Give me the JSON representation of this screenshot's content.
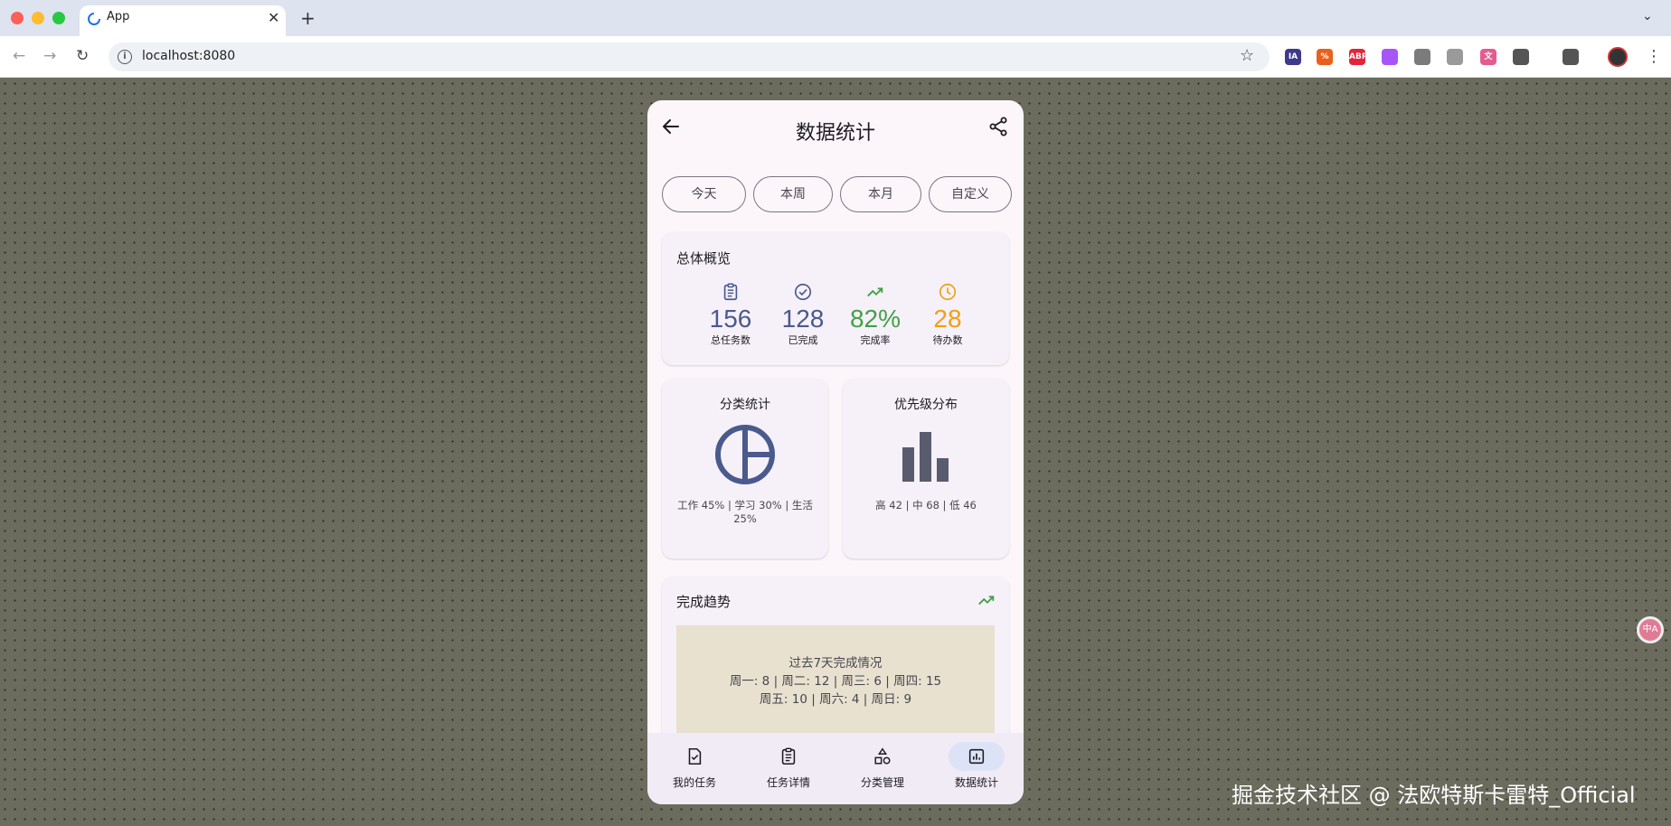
{
  "browser": {
    "tab_title": "App",
    "url": "localhost:8080",
    "tab_close": "✕",
    "new_tab": "+",
    "tab_menu": "⌄",
    "extensions": [
      {
        "name": "ia-extension-icon",
        "label": "IA",
        "color": "#3d3a8c"
      },
      {
        "name": "percent-extension-icon",
        "label": "%",
        "color": "#e8601c"
      },
      {
        "name": "adblock-extension-icon",
        "label": "ABP",
        "color": "#e5243b"
      },
      {
        "name": "purple-extension-icon",
        "label": "",
        "color": "#a855f7"
      },
      {
        "name": "shield-extension-icon",
        "label": "",
        "color": "#7b7b7b"
      },
      {
        "name": "gray-extension-icon",
        "label": "",
        "color": "#9a9a9a"
      },
      {
        "name": "translate-extension-icon",
        "label": "文",
        "color": "#e45c8f"
      },
      {
        "name": "puzzle-extension-icon",
        "label": "",
        "color": "#555555"
      },
      {
        "name": "qr-extension-icon",
        "label": "",
        "color": "#555555"
      }
    ]
  },
  "app": {
    "title": "数据统计",
    "filters": [
      "今天",
      "本周",
      "本月",
      "自定义"
    ],
    "overview": {
      "title": "总体概览",
      "stats": [
        {
          "icon": "clipboard-icon",
          "value": "156",
          "label": "总任务数",
          "color": "#4a5a8c"
        },
        {
          "icon": "check-circle-icon",
          "value": "128",
          "label": "已完成",
          "color": "#4a5a8c"
        },
        {
          "icon": "trending-up-icon",
          "value": "82%",
          "label": "完成率",
          "color": "#43a047"
        },
        {
          "icon": "clock-icon",
          "value": "28",
          "label": "待办数",
          "color": "#f0a010"
        }
      ]
    },
    "category": {
      "title": "分类统计",
      "desc": "工作 45% | 学习 30% | 生活 25%",
      "chart_icon": "pie-chart-icon"
    },
    "priority": {
      "title": "优先级分布",
      "desc": "高 42 | 中 68 | 低 46",
      "chart_icon": "bar-chart-icon"
    },
    "trend": {
      "title": "完成趋势",
      "line1": "过去7天完成情况",
      "line2": "周一: 8 | 周二: 12 | 周三: 6 | 周四: 15",
      "line3": "周五: 10 | 周六: 4 | 周日: 9"
    },
    "nav": [
      {
        "icon": "task-check-icon",
        "label": "我的任务",
        "active": false
      },
      {
        "icon": "clipboard-list-icon",
        "label": "任务详情",
        "active": false
      },
      {
        "icon": "shapes-icon",
        "label": "分类管理",
        "active": false
      },
      {
        "icon": "stats-icon",
        "label": "数据统计",
        "active": true
      }
    ]
  },
  "overlay": {
    "watermark": "掘金技术社区 @ 法欧特斯卡雷特_Official",
    "side_button": "中A"
  },
  "colors": {
    "primary": "#4a5a8c",
    "success": "#43a047",
    "warning": "#f0a010",
    "nav_active_bg": "#dde3f6"
  }
}
